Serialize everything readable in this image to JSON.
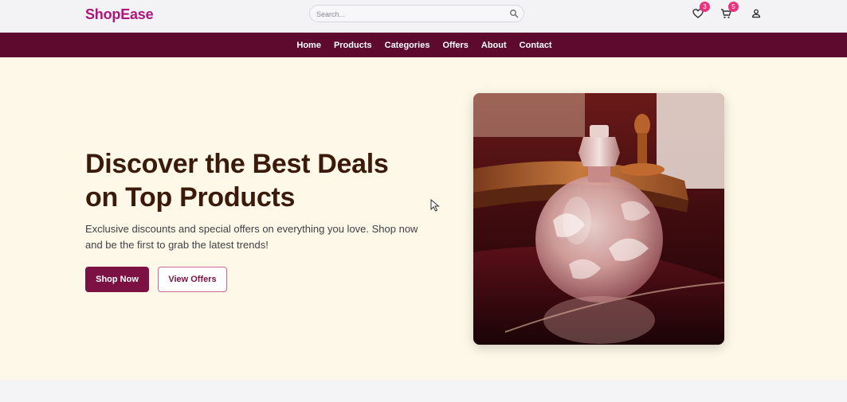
{
  "header": {
    "logo": "ShopEase",
    "search_placeholder": "Search...",
    "wishlist_count": "3",
    "cart_count": "5"
  },
  "nav": {
    "items": [
      "Home",
      "Products",
      "Categories",
      "Offers",
      "About",
      "Contact"
    ]
  },
  "hero": {
    "title_line1": "Discover the Best Deals",
    "title_line2": "on Top Products",
    "description_line1": "Exclusive discounts and special offers on everything you love. Shop now",
    "description_line2": "and be the first to grab the latest trends!",
    "primary_button": "Shop Now",
    "secondary_button": "View Offers"
  },
  "colors": {
    "brand": "#b0157a",
    "nav_bg": "#5e0a2f",
    "hero_bg": "#fdf8e8",
    "badge": "#e8337f",
    "primary_button": "#7c1244"
  },
  "icons": [
    "search-icon",
    "heart-icon",
    "cart-icon",
    "user-icon"
  ]
}
